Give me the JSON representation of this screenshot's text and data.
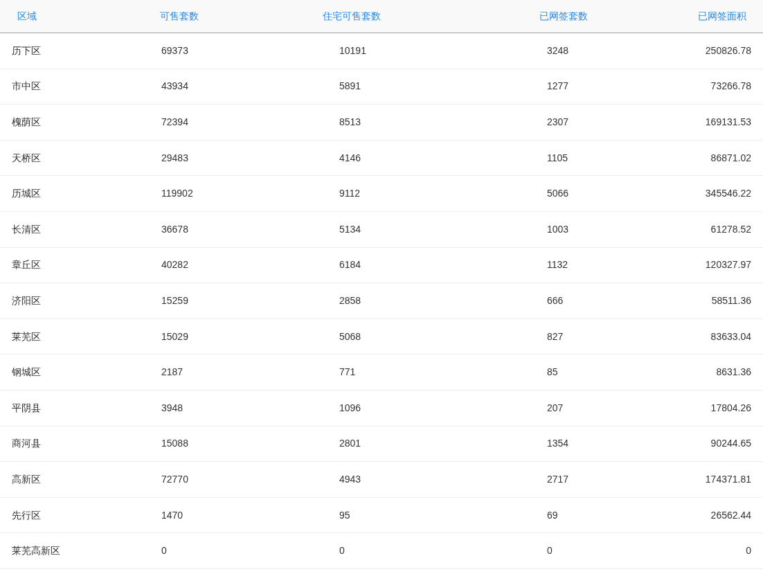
{
  "table": {
    "columns": [
      "区域",
      "可售套数",
      "住宅可售套数",
      "已网签套数",
      "已网签面积"
    ],
    "rows": [
      [
        "历下区",
        "69373",
        "10191",
        "3248",
        "250826.78"
      ],
      [
        "市中区",
        "43934",
        "5891",
        "1277",
        "73266.78"
      ],
      [
        "槐荫区",
        "72394",
        "8513",
        "2307",
        "169131.53"
      ],
      [
        "天桥区",
        "29483",
        "4146",
        "1105",
        "86871.02"
      ],
      [
        "历城区",
        "119902",
        "9112",
        "5066",
        "345546.22"
      ],
      [
        "长清区",
        "36678",
        "5134",
        "1003",
        "61278.52"
      ],
      [
        "章丘区",
        "40282",
        "6184",
        "1132",
        "120327.97"
      ],
      [
        "济阳区",
        "15259",
        "2858",
        "666",
        "58511.36"
      ],
      [
        "莱芜区",
        "15029",
        "5068",
        "827",
        "83633.04"
      ],
      [
        "钢城区",
        "2187",
        "771",
        "85",
        "8631.36"
      ],
      [
        "平阴县",
        "3948",
        "1096",
        "207",
        "17804.26"
      ],
      [
        "商河县",
        "15088",
        "2801",
        "1354",
        "90244.65"
      ],
      [
        "高新区",
        "72770",
        "4943",
        "2717",
        "174371.81"
      ],
      [
        "先行区",
        "1470",
        "95",
        "69",
        "26562.44"
      ],
      [
        "莱芜高新区",
        "0",
        "0",
        "0",
        "0"
      ]
    ]
  }
}
